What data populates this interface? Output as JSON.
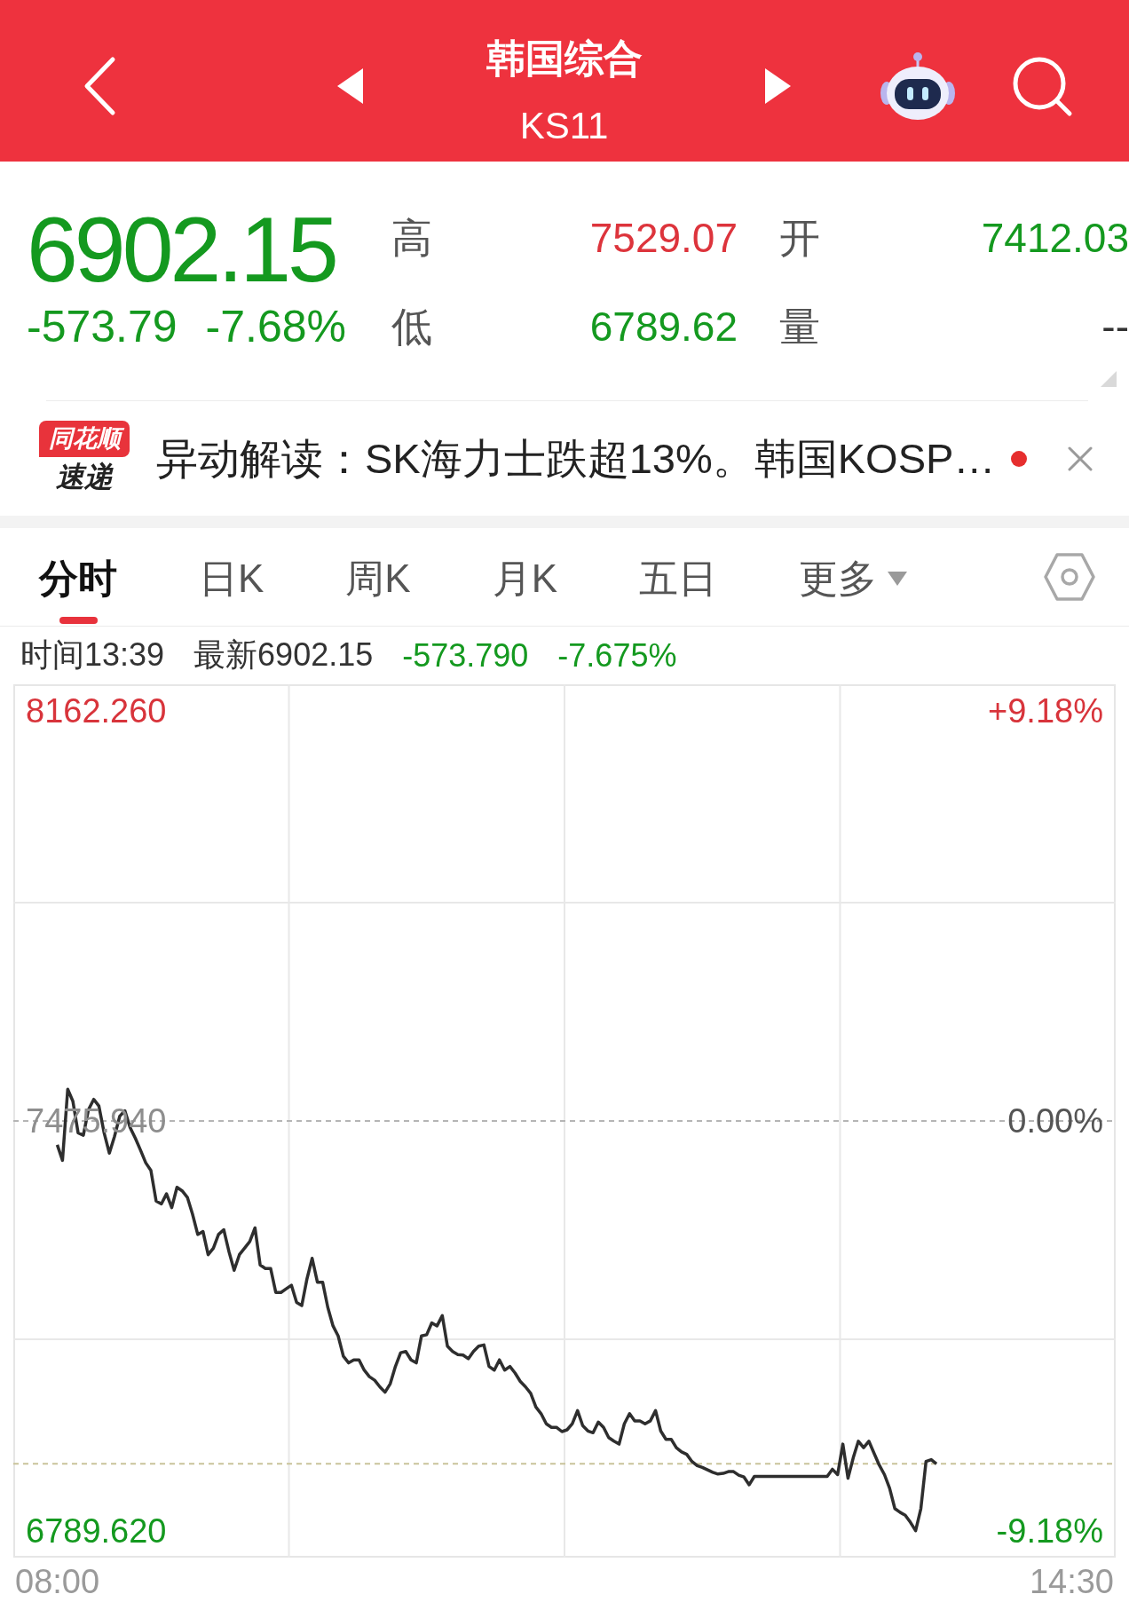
{
  "header": {
    "title": "韩国综合",
    "code": "KS11"
  },
  "quote": {
    "price": "6902.15",
    "change": "-573.79",
    "change_percent": "-7.68%",
    "falling": true,
    "fields": [
      {
        "label": "高",
        "value": "7529.07",
        "color": "#dd343c"
      },
      {
        "label": "开",
        "value": "7412.03",
        "color": "#14991f"
      },
      {
        "label": "低",
        "value": "6789.62",
        "color": "#14991f"
      },
      {
        "label": "量",
        "value": "--",
        "color": "#333333"
      }
    ]
  },
  "news": {
    "logo_tag": "同花顺",
    "logo_text": "速递",
    "headline": "异动解读：SK海力士跌超13%。韩国KOSP…",
    "unread": true
  },
  "tabs": [
    {
      "label": "分时",
      "selected": true,
      "kind": "plain"
    },
    {
      "label": "日K",
      "selected": false,
      "kind": "plain"
    },
    {
      "label": "周K",
      "selected": false,
      "kind": "plain"
    },
    {
      "label": "月K",
      "selected": false,
      "kind": "plain"
    },
    {
      "label": "五日",
      "selected": false,
      "kind": "plain"
    },
    {
      "label": "更多",
      "selected": false,
      "kind": "dropdown"
    }
  ],
  "chart_info": {
    "time": "时间13:39",
    "latest": "最新6902.15",
    "change": "-573.790",
    "change_percent": "-7.675%",
    "falling": true
  },
  "chart": {
    "percent_labels": [
      "+9.18%",
      "0.00%",
      "-9.18%"
    ],
    "chart_data": {
      "type": "line",
      "categories": [
        "08:00",
        null,
        null,
        null,
        null,
        null,
        null,
        null,
        null,
        null,
        null,
        null,
        null,
        null,
        null,
        null,
        null,
        null,
        null,
        null,
        null,
        null,
        null,
        null,
        null,
        null,
        null,
        null,
        null,
        null,
        null,
        null,
        null,
        null,
        null,
        null,
        null,
        null,
        null,
        null,
        null,
        null,
        null,
        null,
        null,
        null,
        null,
        null,
        null,
        null,
        null,
        null,
        null,
        null,
        null,
        null,
        null,
        null,
        null,
        null,
        null,
        null,
        null,
        null,
        null,
        null,
        null,
        null,
        null,
        null,
        null,
        null,
        null,
        null,
        null,
        null,
        null,
        null,
        null,
        null,
        null,
        null,
        null,
        null,
        null,
        null,
        null,
        null,
        null,
        null,
        null,
        null,
        null,
        null,
        null,
        null,
        null,
        null,
        null,
        null,
        null,
        null,
        null,
        null,
        null,
        null,
        null,
        null,
        null,
        null,
        null,
        null,
        null,
        null,
        null,
        null,
        null,
        null,
        null,
        null,
        null,
        null,
        null,
        null,
        null,
        null,
        null,
        null,
        null,
        null,
        null,
        null,
        null,
        null,
        null,
        null,
        null,
        null,
        null,
        null,
        null,
        null,
        null,
        null,
        null,
        null,
        null,
        null,
        null,
        null,
        null,
        null,
        null,
        null,
        null,
        null,
        null,
        null,
        null,
        null,
        null,
        null,
        null,
        null,
        null,
        null,
        null,
        null,
        null,
        null,
        null,
        null,
        null,
        null,
        null,
        null,
        null,
        null,
        null,
        null,
        null,
        null,
        null,
        null,
        null,
        null,
        null,
        null,
        null,
        null,
        null,
        null,
        null,
        null,
        null,
        "14:30"
      ],
      "values": [
        7436,
        7410,
        7529,
        7509,
        7456,
        7452,
        7495,
        7512,
        7501,
        7456,
        7422,
        7450,
        7484,
        7493,
        7465,
        7447,
        7427,
        7406,
        7393,
        7342,
        7337,
        7354,
        7331,
        7365,
        7359,
        7348,
        7320,
        7286,
        7291,
        7252,
        7263,
        7286,
        7294,
        7257,
        7226,
        7252,
        7263,
        7274,
        7297,
        7235,
        7229,
        7229,
        7189,
        7189,
        7195,
        7201,
        7172,
        7167,
        7212,
        7246,
        7206,
        7206,
        7164,
        7133,
        7116,
        7082,
        7071,
        7076,
        7076,
        7059,
        7048,
        7042,
        7031,
        7022,
        7036,
        7065,
        7088,
        7090,
        7076,
        7071,
        7116,
        7118,
        7138,
        7133,
        7150,
        7099,
        7090,
        7085,
        7084,
        7078,
        7090,
        7099,
        7101,
        7065,
        7059,
        7076,
        7059,
        7065,
        7054,
        7040,
        7031,
        7020,
        6997,
        6986,
        6969,
        6963,
        6963,
        6956,
        6959,
        6969,
        6991,
        6966,
        6957,
        6954,
        6972,
        6963,
        6946,
        6940,
        6935,
        6969,
        6986,
        6974,
        6974,
        6969,
        6974,
        6991,
        6957,
        6943,
        6943,
        6929,
        6922,
        6918,
        6906,
        6899,
        6896,
        6892,
        6888,
        6885,
        6886,
        6889,
        6889,
        6883,
        6880,
        6867,
        6881,
        6881,
        6881,
        6881,
        6881,
        6881,
        6881,
        6881,
        6881,
        6881,
        6881,
        6881,
        6881,
        6881,
        6881,
        6893,
        6884,
        6935,
        6878,
        6912,
        6940,
        6929,
        6940,
        6920,
        6900,
        6884,
        6861,
        6827,
        6821,
        6816,
        6804,
        6790,
        6827,
        6906,
        6909,
        6902,
        null,
        null,
        null,
        null,
        null,
        null,
        null,
        null,
        null,
        null,
        null,
        null,
        null,
        null,
        null,
        null,
        null,
        null,
        null,
        null,
        null,
        null,
        null,
        null,
        null,
        null
      ],
      "ylim": [
        6745.05,
        8206.83
      ],
      "yticks": [
        {
          "value": 8162.26,
          "label": "8162.260"
        },
        {
          "value": 7475.94,
          "label": "7475.940"
        },
        {
          "value": 6789.62,
          "label": "6789.620"
        }
      ],
      "ref_lines": [
        {
          "axis": "y",
          "value": 7475.94,
          "color": "#b5b5b5"
        },
        {
          "axis": "y",
          "value": 6902.15,
          "color": "#c9c39a"
        }
      ]
    }
  }
}
